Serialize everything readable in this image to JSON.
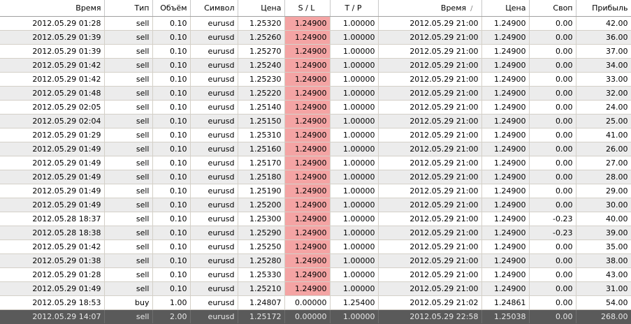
{
  "colors": {
    "row_alt": "#ececec",
    "row": "#ffffff",
    "sl_highlight": "#f4a4a4",
    "summary_bg": "#5a5a5a",
    "summary_text": "#e8e8e8"
  },
  "sort_icon": "sort-indicator-icon",
  "headers": [
    "Время",
    "Тип",
    "Объём",
    "Символ",
    "Цена",
    "S / L",
    "T / P",
    "Время",
    "Цена",
    "Своп",
    "Прибыль"
  ],
  "sort_glyph": "/",
  "rows": [
    [
      "2012.05.29 01:28",
      "sell",
      "0.10",
      "eurusd",
      "1.25320",
      "1.24900",
      "1.00000",
      "2012.05.29 21:00",
      "1.24900",
      "0.00",
      "42.00"
    ],
    [
      "2012.05.29 01:39",
      "sell",
      "0.10",
      "eurusd",
      "1.25260",
      "1.24900",
      "1.00000",
      "2012.05.29 21:00",
      "1.24900",
      "0.00",
      "36.00"
    ],
    [
      "2012.05.29 01:39",
      "sell",
      "0.10",
      "eurusd",
      "1.25270",
      "1.24900",
      "1.00000",
      "2012.05.29 21:00",
      "1.24900",
      "0.00",
      "37.00"
    ],
    [
      "2012.05.29 01:42",
      "sell",
      "0.10",
      "eurusd",
      "1.25240",
      "1.24900",
      "1.00000",
      "2012.05.29 21:00",
      "1.24900",
      "0.00",
      "34.00"
    ],
    [
      "2012.05.29 01:42",
      "sell",
      "0.10",
      "eurusd",
      "1.25230",
      "1.24900",
      "1.00000",
      "2012.05.29 21:00",
      "1.24900",
      "0.00",
      "33.00"
    ],
    [
      "2012.05.29 01:48",
      "sell",
      "0.10",
      "eurusd",
      "1.25220",
      "1.24900",
      "1.00000",
      "2012.05.29 21:00",
      "1.24900",
      "0.00",
      "32.00"
    ],
    [
      "2012.05.29 02:05",
      "sell",
      "0.10",
      "eurusd",
      "1.25140",
      "1.24900",
      "1.00000",
      "2012.05.29 21:00",
      "1.24900",
      "0.00",
      "24.00"
    ],
    [
      "2012.05.29 02:04",
      "sell",
      "0.10",
      "eurusd",
      "1.25150",
      "1.24900",
      "1.00000",
      "2012.05.29 21:00",
      "1.24900",
      "0.00",
      "25.00"
    ],
    [
      "2012.05.29 01:29",
      "sell",
      "0.10",
      "eurusd",
      "1.25310",
      "1.24900",
      "1.00000",
      "2012.05.29 21:00",
      "1.24900",
      "0.00",
      "41.00"
    ],
    [
      "2012.05.29 01:49",
      "sell",
      "0.10",
      "eurusd",
      "1.25160",
      "1.24900",
      "1.00000",
      "2012.05.29 21:00",
      "1.24900",
      "0.00",
      "26.00"
    ],
    [
      "2012.05.29 01:49",
      "sell",
      "0.10",
      "eurusd",
      "1.25170",
      "1.24900",
      "1.00000",
      "2012.05.29 21:00",
      "1.24900",
      "0.00",
      "27.00"
    ],
    [
      "2012.05.29 01:49",
      "sell",
      "0.10",
      "eurusd",
      "1.25180",
      "1.24900",
      "1.00000",
      "2012.05.29 21:00",
      "1.24900",
      "0.00",
      "28.00"
    ],
    [
      "2012.05.29 01:49",
      "sell",
      "0.10",
      "eurusd",
      "1.25190",
      "1.24900",
      "1.00000",
      "2012.05.29 21:00",
      "1.24900",
      "0.00",
      "29.00"
    ],
    [
      "2012.05.29 01:49",
      "sell",
      "0.10",
      "eurusd",
      "1.25200",
      "1.24900",
      "1.00000",
      "2012.05.29 21:00",
      "1.24900",
      "0.00",
      "30.00"
    ],
    [
      "2012.05.28 18:37",
      "sell",
      "0.10",
      "eurusd",
      "1.25300",
      "1.24900",
      "1.00000",
      "2012.05.29 21:00",
      "1.24900",
      "-0.23",
      "40.00"
    ],
    [
      "2012.05.28 18:38",
      "sell",
      "0.10",
      "eurusd",
      "1.25290",
      "1.24900",
      "1.00000",
      "2012.05.29 21:00",
      "1.24900",
      "-0.23",
      "39.00"
    ],
    [
      "2012.05.29 01:42",
      "sell",
      "0.10",
      "eurusd",
      "1.25250",
      "1.24900",
      "1.00000",
      "2012.05.29 21:00",
      "1.24900",
      "0.00",
      "35.00"
    ],
    [
      "2012.05.29 01:38",
      "sell",
      "0.10",
      "eurusd",
      "1.25280",
      "1.24900",
      "1.00000",
      "2012.05.29 21:00",
      "1.24900",
      "0.00",
      "38.00"
    ],
    [
      "2012.05.29 01:28",
      "sell",
      "0.10",
      "eurusd",
      "1.25330",
      "1.24900",
      "1.00000",
      "2012.05.29 21:00",
      "1.24900",
      "0.00",
      "43.00"
    ],
    [
      "2012.05.29 01:49",
      "sell",
      "0.10",
      "eurusd",
      "1.25210",
      "1.24900",
      "1.00000",
      "2012.05.29 21:00",
      "1.24900",
      "0.00",
      "31.00"
    ],
    [
      "2012.05.29 18:53",
      "buy",
      "1.00",
      "eurusd",
      "1.24807",
      "0.00000",
      "1.25400",
      "2012.05.29 21:02",
      "1.24861",
      "0.00",
      "54.00"
    ]
  ],
  "highlighted_sl_rows": 20,
  "summary_row": [
    "2012.05.29 14:07",
    "sell",
    "2.00",
    "eurusd",
    "1.25172",
    "0.00000",
    "1.00000",
    "2012.05.29 22:58",
    "1.25038",
    "0.00",
    "268.00"
  ]
}
